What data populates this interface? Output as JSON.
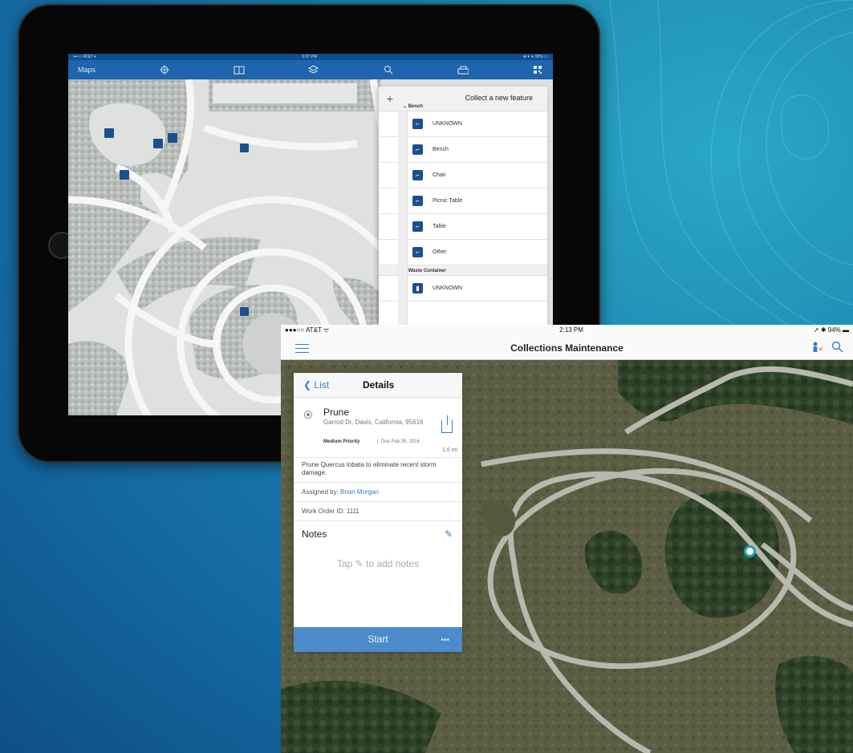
{
  "ipad": {
    "status": {
      "carrier": "•••○○ AT&T ▾",
      "time": "5:07 PM",
      "battery": "⊕ ▾ ∗ 95% ▭"
    },
    "toolbar": {
      "maps_label": "Maps"
    },
    "collect_panel": {
      "title": "Collect a new feature",
      "groups": [
        {
          "label": "Bench",
          "items": [
            "UNKNOWN",
            "Bench",
            "Chair",
            "Picnic Table",
            "Table",
            "Other"
          ]
        },
        {
          "label": "Waste Container",
          "items": [
            "UNKNOWN"
          ]
        }
      ]
    }
  },
  "phone": {
    "status": {
      "carrier": "●●●○○ AT&T ᯤ",
      "time": "2:13 PM",
      "battery": "➚ ✱ 94% ▬"
    },
    "title": "Collections Maintenance",
    "details": {
      "back_label": "List",
      "header": "Details",
      "name": "Prune",
      "address": "Garrod Dr, Davis, California, 95616",
      "priority": "Medium Priority",
      "due": "Due Feb 26, 2016",
      "distance": "1.6 mi",
      "description": "Prune Quercus lobata to eliminate recent storm damage.",
      "assigned_prefix": "Assigned by: ",
      "assigned_name": "Brian Morgan",
      "work_order": "Work Order ID: 1111",
      "notes_label": "Notes",
      "tap_text": "Tap ✎ to add notes",
      "start_label": "Start",
      "more_label": "•••"
    }
  },
  "colors": {
    "accent": "#2f7fd0",
    "toolbar": "#1e65ad",
    "start_bar": "#4d8ccb",
    "location_ring": "#19a2b8"
  }
}
